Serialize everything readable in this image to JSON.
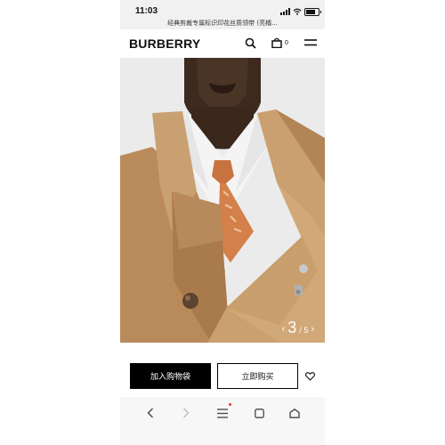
{
  "status_bar": {
    "time": "11:03"
  },
  "browser": {
    "url_title": "经典剪裁专属标识印花丝质领带 (亮橘..."
  },
  "header": {
    "logo": "BURBERRY",
    "bag_count": "0"
  },
  "gallery": {
    "current": "3",
    "separator_total": "/ 5",
    "prev": "‹",
    "next": "›"
  },
  "actions": {
    "add_to_bag": "加入购物袋",
    "buy_now": "立即购买"
  },
  "colors": {
    "accent": "#000000",
    "coat": "#c49a6c",
    "shirt": "#f4f4f4",
    "tie": "#d3804a"
  },
  "icons": [
    "search-icon",
    "shopping-bag-icon",
    "menu-icon",
    "heart-icon",
    "back-icon",
    "forward-icon",
    "menu-lines-icon",
    "tabs-icon",
    "home-icon"
  ]
}
